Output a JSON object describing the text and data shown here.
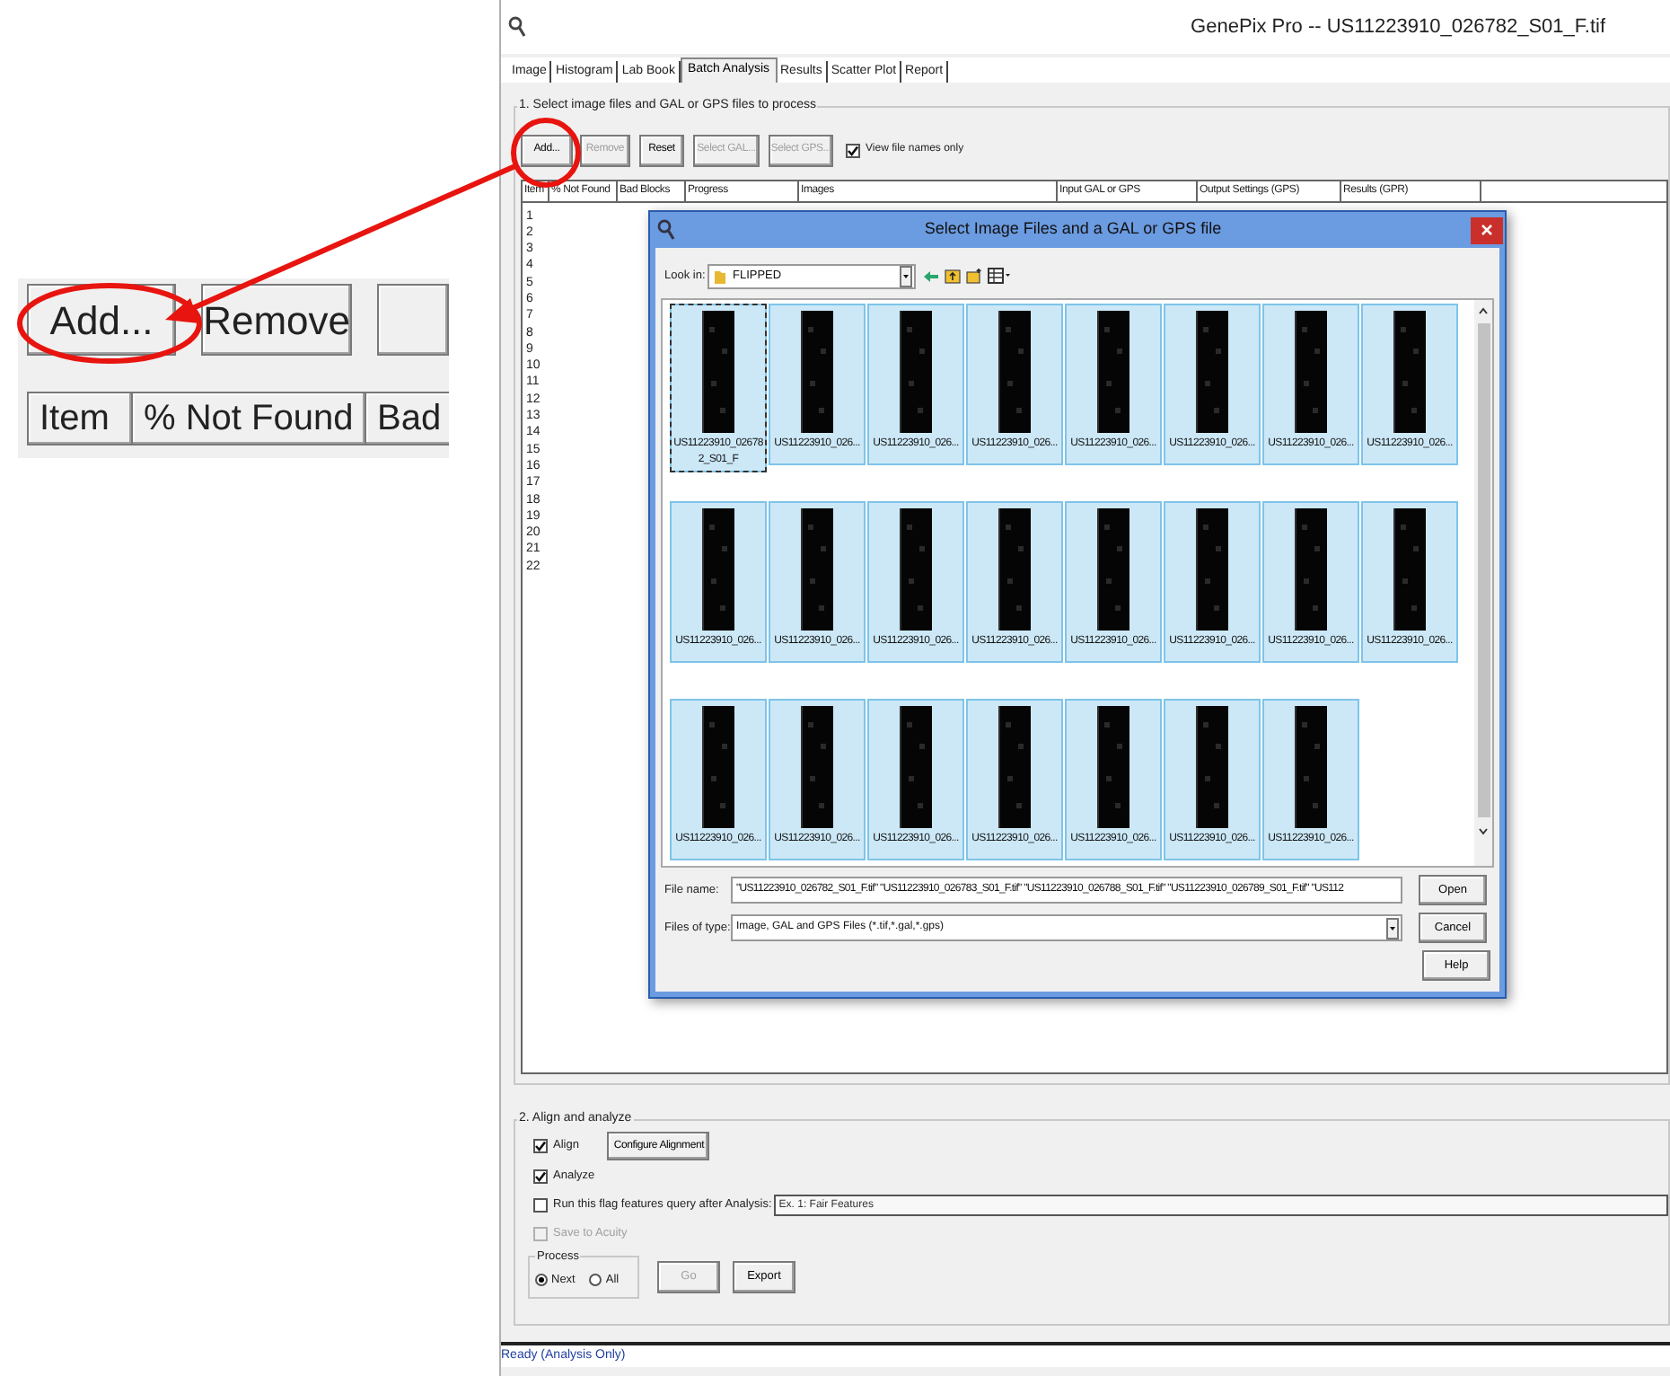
{
  "callout": {
    "buttons": [
      "Add...",
      "Remove"
    ],
    "columns": [
      "Item",
      "% Not Found",
      "Bad"
    ]
  },
  "window": {
    "title": "GenePix Pro -- US11223910_026782_S01_F.tif"
  },
  "tabs": [
    {
      "label": "Image",
      "selected": false
    },
    {
      "label": "Histogram",
      "selected": false
    },
    {
      "label": "Lab Book",
      "selected": false
    },
    {
      "label": "Batch Analysis",
      "selected": true
    },
    {
      "label": "Results",
      "selected": false
    },
    {
      "label": "Scatter Plot",
      "selected": false
    },
    {
      "label": "Report",
      "selected": false
    }
  ],
  "select_group": {
    "title": "1. Select image files and GAL or GPS files to process",
    "buttons": [
      {
        "label": "Add...",
        "disabled": false
      },
      {
        "label": "Remove",
        "disabled": true
      },
      {
        "label": "Reset",
        "disabled": false
      },
      {
        "label": "Select GAL...",
        "disabled": true
      },
      {
        "label": "Select GPS...",
        "disabled": true
      }
    ],
    "view_names_only": {
      "label": "View file names only",
      "checked": true
    },
    "table": {
      "columns": [
        "Item",
        "% Not Found",
        "Bad Blocks",
        "Progress",
        "Images",
        "Input GAL or GPS",
        "Output Settings (GPS)",
        "Results (GPR)"
      ],
      "rows": [
        "1",
        "2",
        "3",
        "4",
        "5",
        "6",
        "7",
        "8",
        "9",
        "10",
        "11",
        "12",
        "13",
        "14",
        "15",
        "16",
        "17",
        "18",
        "19",
        "20",
        "21",
        "22"
      ]
    }
  },
  "dialog": {
    "title": "Select Image Files and a GAL or GPS file",
    "look_in": {
      "label": "Look in:",
      "value": "FLIPPED"
    },
    "files": [
      {
        "name": "US11223910_026782_S01_F",
        "selected": true,
        "focused": true
      },
      {
        "name": "US11223910_026...",
        "selected": true,
        "focused": false
      },
      {
        "name": "US11223910_026...",
        "selected": true,
        "focused": false
      },
      {
        "name": "US11223910_026...",
        "selected": true,
        "focused": false
      },
      {
        "name": "US11223910_026...",
        "selected": true,
        "focused": false
      },
      {
        "name": "US11223910_026...",
        "selected": true,
        "focused": false
      },
      {
        "name": "US11223910_026...",
        "selected": true,
        "focused": false
      },
      {
        "name": "US11223910_026...",
        "selected": true,
        "focused": false
      },
      {
        "name": "US11223910_026...",
        "selected": true,
        "focused": false
      },
      {
        "name": "US11223910_026...",
        "selected": true,
        "focused": false
      },
      {
        "name": "US11223910_026...",
        "selected": true,
        "focused": false
      },
      {
        "name": "US11223910_026...",
        "selected": true,
        "focused": false
      },
      {
        "name": "US11223910_026...",
        "selected": true,
        "focused": false
      },
      {
        "name": "US11223910_026...",
        "selected": true,
        "focused": false
      },
      {
        "name": "US11223910_026...",
        "selected": true,
        "focused": false
      },
      {
        "name": "US11223910_026...",
        "selected": true,
        "focused": false
      },
      {
        "name": "US11223910_026...",
        "selected": true,
        "focused": false
      },
      {
        "name": "US11223910_026...",
        "selected": true,
        "focused": false
      },
      {
        "name": "US11223910_026...",
        "selected": true,
        "focused": false
      },
      {
        "name": "US11223910_026...",
        "selected": true,
        "focused": false
      },
      {
        "name": "US11223910_026...",
        "selected": true,
        "focused": false
      },
      {
        "name": "US11223910_026...",
        "selected": true,
        "focused": false
      },
      {
        "name": "US11223910_026...",
        "selected": true,
        "focused": false
      }
    ],
    "file_name": {
      "label": "File name:",
      "value": "\"US11223910_026782_S01_F.tif\" \"US11223910_026783_S01_F.tif\" \"US11223910_026788_S01_F.tif\" \"US11223910_026789_S01_F.tif\" \"US112"
    },
    "file_type": {
      "label": "Files of type:",
      "value": "Image, GAL and GPS Files (*.tif,*.gal,*.gps)"
    },
    "buttons": [
      "Open",
      "Cancel",
      "Help"
    ]
  },
  "align_group": {
    "title": "2. Align and analyze",
    "align": {
      "label": "Align",
      "checked": true
    },
    "configure_button": "Configure Alignment",
    "analyze": {
      "label": "Analyze",
      "checked": true
    },
    "flag_query": {
      "label": "Run this flag features query after Analysis:",
      "checked": false,
      "value": "Ex. 1: Fair Features"
    },
    "save_to_acuity": {
      "label": "Save to Acuity",
      "checked": false,
      "disabled": true
    },
    "process": {
      "title": "Process",
      "options": [
        {
          "label": "Next",
          "selected": true
        },
        {
          "label": "All",
          "selected": false
        }
      ]
    },
    "buttons": [
      {
        "label": "Go",
        "disabled": true
      },
      {
        "label": "Export",
        "disabled": false
      }
    ]
  },
  "status_bar": "Ready (Analysis Only)"
}
